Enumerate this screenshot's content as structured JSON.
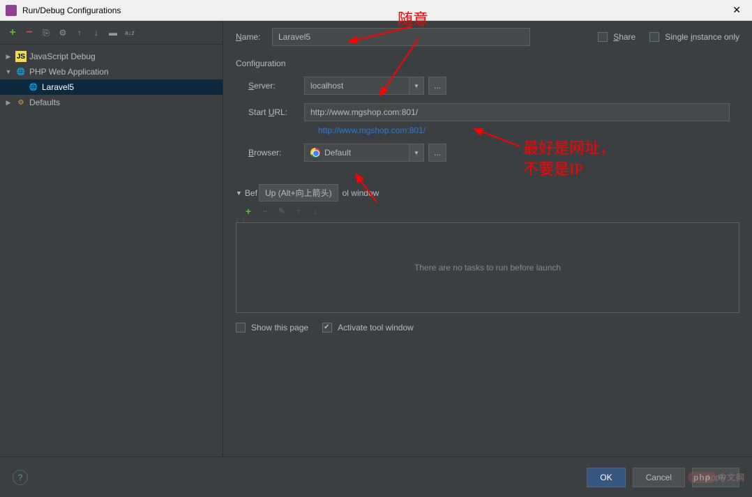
{
  "window": {
    "title": "Run/Debug Configurations"
  },
  "toolbar": {
    "add_icon": "+",
    "remove_icon": "−",
    "copy_icon": "⎘",
    "wrench_icon": "🔧",
    "up_icon": "↑",
    "down_icon": "↓",
    "folder_icon": "📁",
    "sort_icon": "a↓z"
  },
  "tree": {
    "items": [
      {
        "label": "JavaScript Debug",
        "icon": "JS",
        "expanded": false,
        "children": []
      },
      {
        "label": "PHP Web Application",
        "icon": "🌐",
        "expanded": true,
        "children": [
          {
            "label": "Laravel5",
            "icon": "🌐",
            "selected": true
          }
        ]
      },
      {
        "label": "Defaults",
        "icon": "⚙",
        "expanded": false,
        "children": []
      }
    ]
  },
  "form": {
    "name_label": "Name:",
    "name_value": "Laravel5",
    "share_label": "Share",
    "single_instance_label": "Single instance only",
    "share_checked": false,
    "single_instance_checked": false,
    "configuration_label": "Configuration",
    "server_label": "Server:",
    "server_value": "localhost",
    "start_url_label": "Start URL:",
    "start_url_value": "http://www.mgshop.com:801/",
    "start_url_link": "http://www.mgshop.com:801/",
    "browser_label": "Browser:",
    "browser_value": "Default",
    "dots": "..."
  },
  "before_launch": {
    "header_prefix": "Bef",
    "tooltip": "Up (Alt+向上箭头)",
    "header_suffix": "ol window",
    "empty_text": "There are no tasks to run before launch",
    "show_this_page_label": "Show this page",
    "activate_tool_window_label": "Activate tool window",
    "show_this_page_checked": false,
    "activate_tool_window_checked": true
  },
  "footer": {
    "help": "?",
    "ok": "OK",
    "cancel": "Cancel",
    "apply": "Apply"
  },
  "annotations": {
    "a1": "随意",
    "a2": "最好是网址，",
    "a3": "不要是IP"
  },
  "watermark": {
    "brand": "php",
    "suffix": "中文网"
  }
}
